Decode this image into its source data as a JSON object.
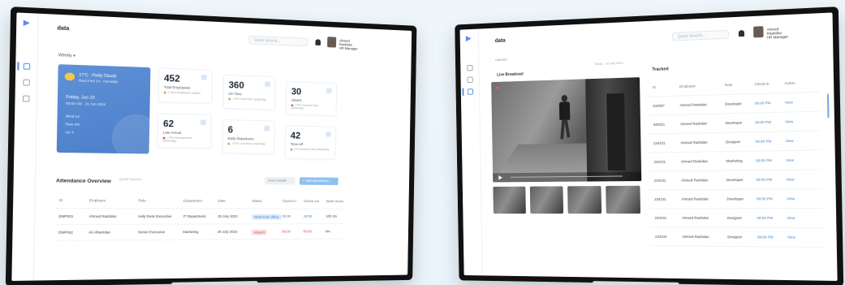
{
  "left_screen": {
    "title": "data",
    "search_placeholder": "Quick Search...",
    "filter_label": "Weekly",
    "weather": {
      "temp": "17°C · Partly Cloudy",
      "condition": "Real Feel 14 · Humidity",
      "date": "Friday, Jun 23",
      "time": "09:00 AM · 21 Jun 2024",
      "rows": [
        "Wind 12",
        "Rain 0%",
        "UV 4"
      ]
    },
    "stats": [
      {
        "value": "452",
        "label": "Total Employees",
        "note": "2 new employees added"
      },
      {
        "value": "360",
        "label": "On Time",
        "note": "-10% Less than yesterday"
      },
      {
        "value": "30",
        "label": "Absent",
        "note": "+3% Increase than yesterday"
      },
      {
        "value": "62",
        "label": "Late Arrival",
        "note": "+3% Increase than yesterday"
      },
      {
        "value": "6",
        "label": "Early Departures",
        "note": "-10% Less than yesterday"
      },
      {
        "value": "42",
        "label": "Time-off",
        "note": "2% Increase than yesterday"
      }
    ],
    "section_title": "Attendance Overview",
    "section_search": "Quick Search...",
    "btn_secondary": "View Details",
    "btn_primary": "+ Add Attendance",
    "table_headers": [
      "ID",
      "Employee",
      "Role",
      "Department",
      "Date",
      "Status",
      "Check-in",
      "Check-out",
      "Work Hours"
    ],
    "rows": [
      {
        "id": "EMP001",
        "name": "Ahmed Rashdan",
        "role": "Help Desk Executive",
        "dept": "IT Department",
        "date": "29 July 2023",
        "status": "Work from office",
        "status_type": "blue",
        "in": "09:00",
        "out": "18:00",
        "hours": "10h 2m"
      },
      {
        "id": "EMP002",
        "name": "Ali Alhamdan",
        "role": "Senior Executive",
        "dept": "Marketing",
        "date": "29 July 2023",
        "status": "Absent",
        "status_type": "red",
        "in": "00:00",
        "out": "00:00",
        "hours": "0m"
      }
    ]
  },
  "right_screen": {
    "title": "data",
    "subtitle": "Camera",
    "search_placeholder": "Quick Search...",
    "camera_title": "Live Broadcast",
    "camera_date": "Today · 12 July 2023",
    "table_title": "Tracked",
    "table_headers": [
      "ID",
      "Employee",
      "Role",
      "Check-in",
      "Action"
    ],
    "rows": [
      {
        "id": "234567",
        "name": "Ahmed Rashdan",
        "role": "Developer",
        "time": "09:00 PM",
        "action": "View"
      },
      {
        "id": "345321",
        "name": "Ahmed Rashdan",
        "role": "Developer",
        "time": "09:00 PM",
        "action": "View"
      },
      {
        "id": "234231",
        "name": "Ahmed Rashdan",
        "role": "Designer",
        "time": "09:00 PM",
        "action": "View"
      },
      {
        "id": "234231",
        "name": "Ahmed Rashdan",
        "role": "Marketing",
        "time": "09:00 PM",
        "action": "View"
      },
      {
        "id": "234231",
        "name": "Ahmed Rashdan",
        "role": "Developer",
        "time": "09:00 PM",
        "action": "View"
      },
      {
        "id": "234231",
        "name": "Ahmed Rashdan",
        "role": "Developer",
        "time": "09:00 PM",
        "action": "View"
      },
      {
        "id": "234231",
        "name": "Ahmed Rashdan",
        "role": "Designer",
        "time": "09:00 PM",
        "action": "View"
      },
      {
        "id": "234231",
        "name": "Ahmed Rashdan",
        "role": "Designer",
        "time": "09:00 PM",
        "action": "View"
      }
    ]
  },
  "user": {
    "name": "Ahmed Rashdan",
    "role": "HR Manager"
  },
  "colors": {
    "accent": "#4a90e2",
    "weather_card": "#5b8ed6",
    "danger": "#d24b4b"
  }
}
